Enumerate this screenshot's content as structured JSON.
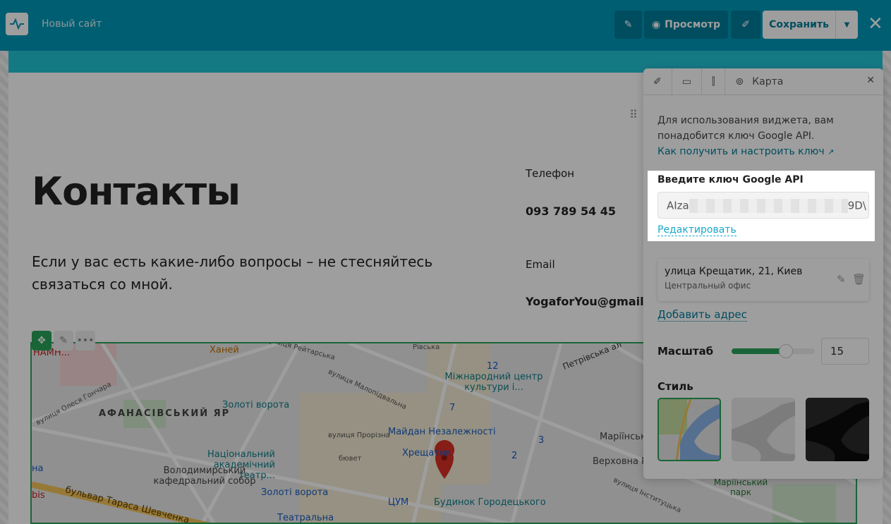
{
  "topbar": {
    "site_name": "Новый сайт",
    "preview": "Просмотр",
    "save": "Сохранить",
    "accent": "#0098b8"
  },
  "content": {
    "title": "Контакты",
    "lead": "Если у вас есть какие-либо вопросы – не стесняйтесь связаться со мной.",
    "phone_label": "Телефон",
    "phone": "093 789 54 45",
    "email_label": "Email",
    "email": "YogaforYou@gmail."
  },
  "map": {
    "labels": [
      "НАМН...",
      "Ханей",
      "вулиця Рейтарська",
      "Рівська",
      "Петрівська ал",
      "12",
      "Міжнародний центр культури і...",
      "вулиця Малопідвальна",
      "вулиця Олеся Гончара",
      "АФАНАСІВСЬКИЙ ЯР",
      "Золоті ворота",
      "7",
      "вулиця Прорізна",
      "Майдан Незалежності",
      "Маріїнськ",
      "3",
      "Національний академічний театр...",
      "Хрещатик",
      "2",
      "бювет",
      "Верховна Р",
      "Володимирський кафедральний собор",
      "Золоті ворота",
      "ЦУМ",
      "Будинок Городецького",
      "Маріїнський парк",
      "бульвар Тараса Шевченка",
      "Театральна",
      "вулиця Інституцька",
      "bis",
      "на"
    ]
  },
  "panel": {
    "breadcrumb": "Карта",
    "intro": "Для использования виджета, вам понадобится ключ Google API.",
    "howto": "Как получить и настроить ключ",
    "api_label": "Введите ключ Google API",
    "api_start": "AIza",
    "api_end": "9D\\",
    "edit": "Редактировать",
    "address": "улица Крещатик, 21, Киев",
    "address_note": "Центральный офис",
    "add_address": "Добавить адрес",
    "scale_label": "Масштаб",
    "scale": 15,
    "scale_fraction": 0.65,
    "style_label": "Стиль",
    "styles": [
      "standard",
      "silver",
      "dark"
    ],
    "selected_style": "standard"
  }
}
